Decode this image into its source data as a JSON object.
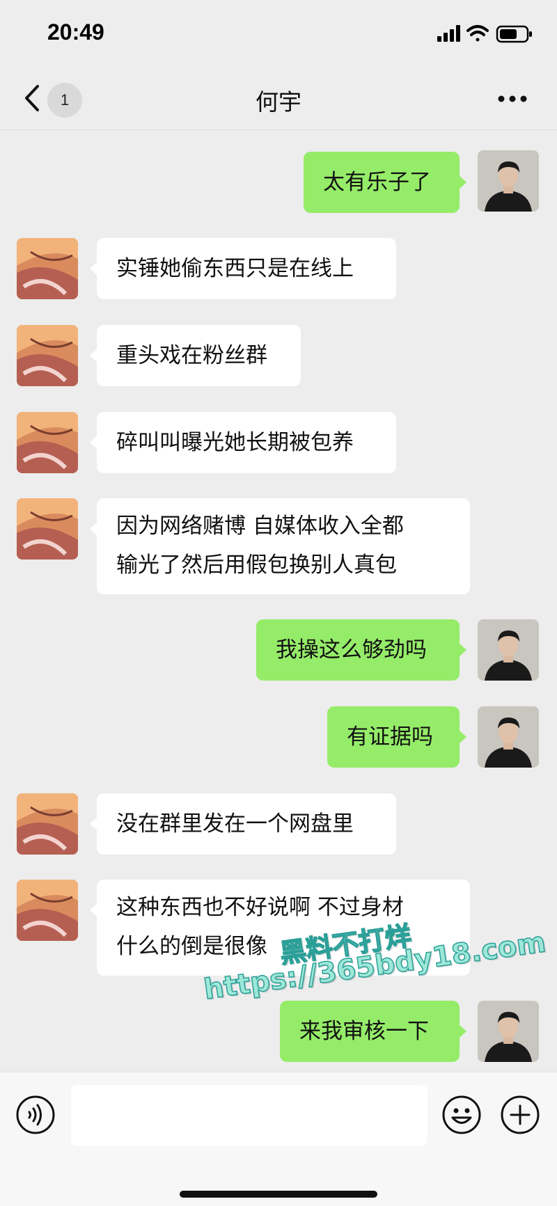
{
  "status_bar": {
    "time": "20:49"
  },
  "nav": {
    "unread_count": "1",
    "title": "何宇"
  },
  "messages": [
    {
      "dir": "out",
      "text": "太有乐子了"
    },
    {
      "dir": "in",
      "text": "实锤她偷东西只是在线上"
    },
    {
      "dir": "in",
      "text": "重头戏在粉丝群"
    },
    {
      "dir": "in",
      "text": "碎叫叫曝光她长期被包养"
    },
    {
      "dir": "in",
      "text": "因为网络赌博 自媒体收入全都\n输光了然后用假包换别人真包"
    },
    {
      "dir": "out",
      "text": "我操这么够劲吗"
    },
    {
      "dir": "out",
      "text": "有证据吗"
    },
    {
      "dir": "in",
      "text": "没在群里发在一个网盘里"
    },
    {
      "dir": "in",
      "text": "这种东西也不好说啊 不过身材\n什么的倒是很像"
    },
    {
      "dir": "out",
      "text": "来我审核一下"
    }
  ],
  "input": {
    "value": ""
  },
  "watermark": {
    "line1": "黑料不打烊",
    "line2": "https://365bdy18.com"
  },
  "colors": {
    "background": "#ededed",
    "outgoing_bubble": "#95ec69",
    "incoming_bubble": "#ffffff"
  }
}
